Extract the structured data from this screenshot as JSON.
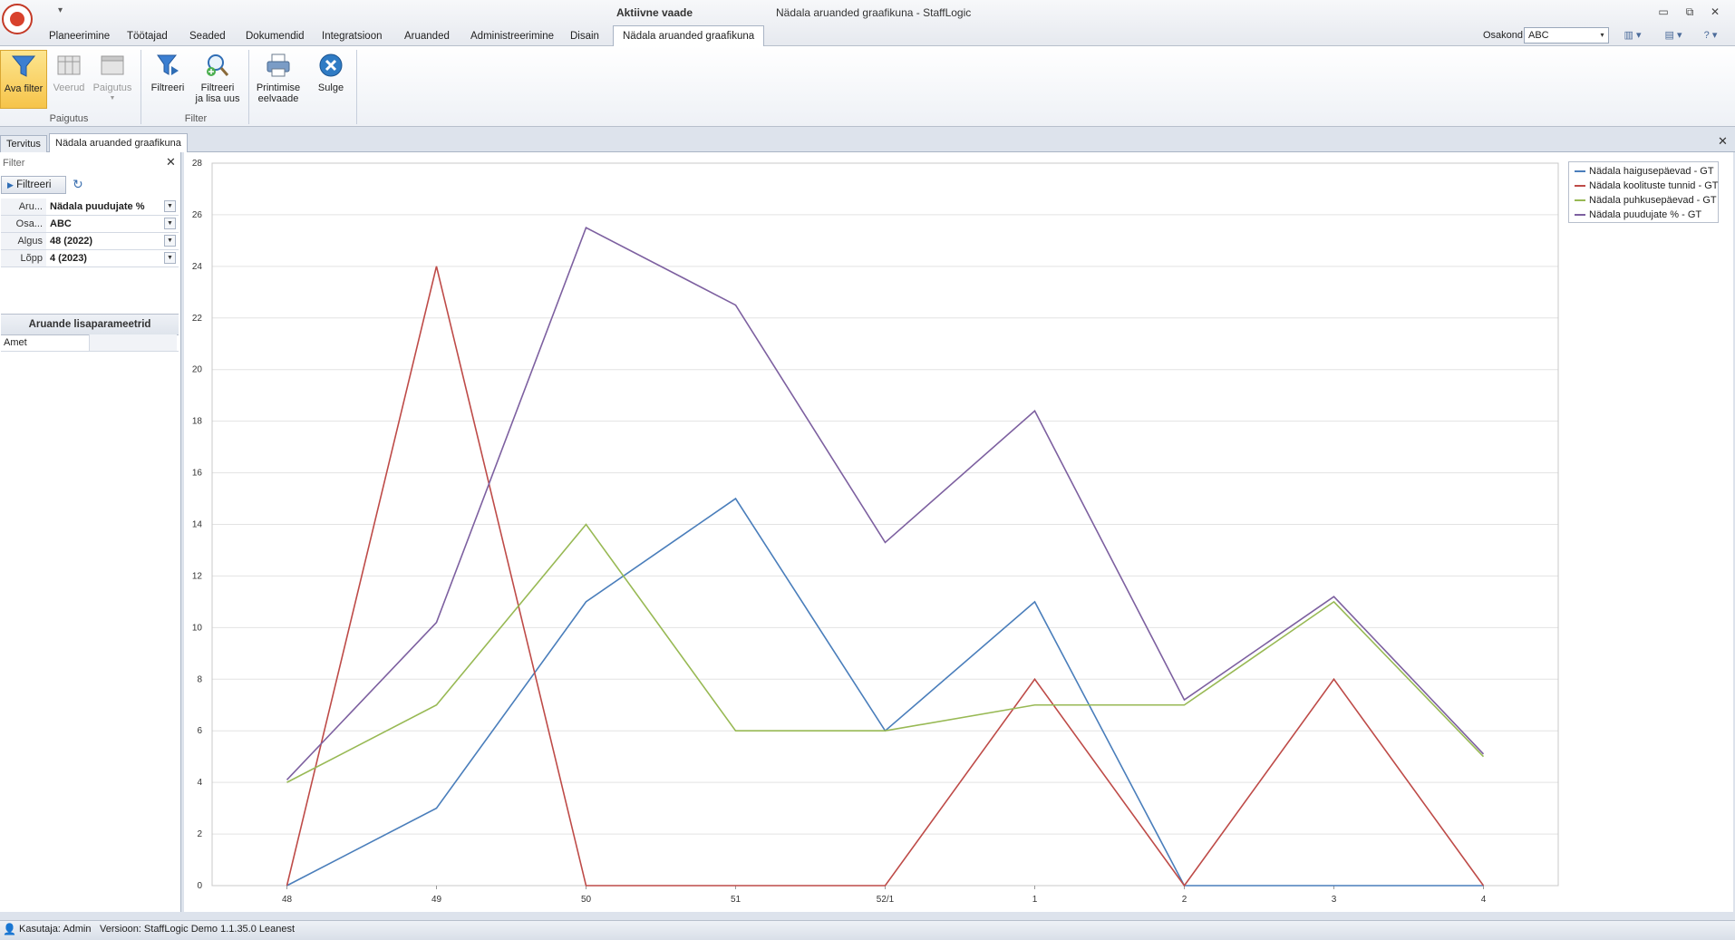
{
  "window": {
    "mode_title": "Aktiivne vaade",
    "title": "Nädala aruanded graafikuna - StaffLogic",
    "qat_glyph": "▾",
    "minimize_glyph": "▭",
    "restore_glyph": "⧉",
    "close_glyph": "✕"
  },
  "menu_tabs": [
    {
      "label": "Planeerimine"
    },
    {
      "label": "Töötajad"
    },
    {
      "label": "Seaded"
    },
    {
      "label": "Dokumendid"
    },
    {
      "label": "Integratsioon"
    },
    {
      "label": "Aruanded"
    },
    {
      "label": "Administreerimine"
    },
    {
      "label": "Disain"
    },
    {
      "label": "Nädala aruanded graafikuna",
      "active": true
    }
  ],
  "osakond": {
    "label": "Osakond",
    "value": "ABC",
    "arrow": "▾"
  },
  "top_icons": {
    "layout_icon": "▥ ▾",
    "window_icon": "▤ ▾",
    "help_icon": "? ▾"
  },
  "ribbon": {
    "buttons": {
      "ava_filter": "Ava filter",
      "veerud": "Veerud",
      "paigutus": "Paigutus",
      "filtreeri": "Filtreeri",
      "filtreeri_lisa_line1": "Filtreeri",
      "filtreeri_lisa_line2": "ja lisa uus",
      "printimise_line1": "Printimise",
      "printimise_line2": "eelvaade",
      "sulge": "Sulge"
    },
    "groups": {
      "paigutus": "Paigutus",
      "filter": "Filter"
    }
  },
  "doc_tabs": [
    {
      "label": "Tervitus"
    },
    {
      "label": "Nädala aruanded graafikuna",
      "active": true
    }
  ],
  "doc_close": "✕",
  "filter_panel": {
    "title": "Filter",
    "close": "✕",
    "filtreeri_button": "Filtreeri",
    "refresh_glyph": "↻",
    "drop_glyph": "▼",
    "params": [
      {
        "label": "Aru...",
        "value": "Nädala puudujate %"
      },
      {
        "label": "Osa...",
        "value": "ABC"
      },
      {
        "label": "Algus",
        "value": "48 (2022)"
      },
      {
        "label": "Lõpp",
        "value": "4 (2023)"
      }
    ],
    "extra_header": "Aruande lisaparameetrid",
    "extra_params": [
      {
        "label": "Amet",
        "value": ""
      }
    ]
  },
  "status": {
    "user_glyph": "👤",
    "user": "Kasutaja: Admin",
    "version": "Versioon: StaffLogic Demo 1.1.35.0 Leanest"
  },
  "colors": {
    "chart_blue": "#4a7ebb",
    "chart_red": "#be4b48",
    "chart_green": "#98b954",
    "chart_purple": "#7d60a0"
  },
  "chart_data": {
    "type": "line",
    "categories": [
      "48",
      "49",
      "50",
      "51",
      "52/1",
      "1",
      "2",
      "3",
      "4"
    ],
    "ylim": [
      0,
      28
    ],
    "yticks": [
      0,
      2,
      4,
      6,
      8,
      10,
      12,
      14,
      16,
      18,
      20,
      22,
      24,
      26,
      28
    ],
    "grid": true,
    "legend_position": "top-right",
    "series": [
      {
        "name": "Nädala haigusepäevad - GT",
        "color": "#4a7ebb",
        "values": [
          0,
          3,
          11,
          15,
          6,
          11,
          0,
          0,
          0
        ]
      },
      {
        "name": "Nädala koolituste tunnid - GT",
        "color": "#be4b48",
        "values": [
          0,
          24,
          0,
          0,
          0,
          8,
          0,
          8,
          0
        ]
      },
      {
        "name": "Nädala puhkusepäevad - GT",
        "color": "#98b954",
        "values": [
          4,
          7,
          14,
          6,
          6,
          7,
          7,
          11,
          5
        ]
      },
      {
        "name": "Nädala puudujate % - GT",
        "color": "#7d60a0",
        "values": [
          4.1,
          10.2,
          25.5,
          22.5,
          13.3,
          18.4,
          7.2,
          11.2,
          5.1
        ]
      }
    ]
  }
}
